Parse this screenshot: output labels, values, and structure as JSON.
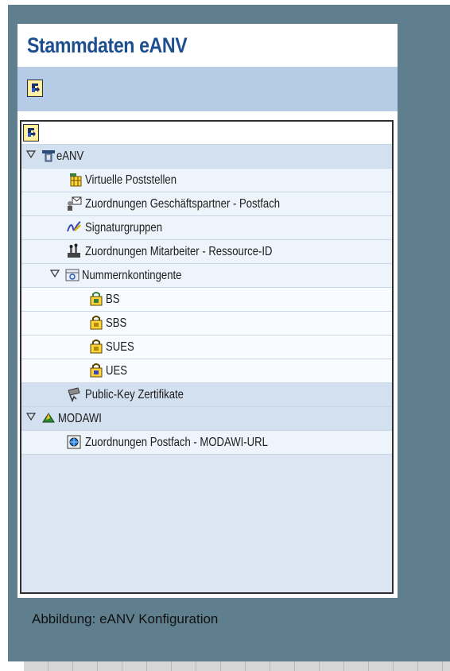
{
  "header": {
    "title": "Stammdaten eANV"
  },
  "toolbar": {
    "refresh_icon": "refresh-icon"
  },
  "tree": {
    "nodes": [
      {
        "label": "eANV",
        "icon": "eanv-node-icon",
        "expanded": true,
        "level": 0
      },
      {
        "label": "Virtuelle Poststellen",
        "icon": "virtual-mailbox-icon",
        "level": 1
      },
      {
        "label": "Zuordnungen Geschäftspartner - Postfach",
        "icon": "partner-mailbox-icon",
        "level": 1
      },
      {
        "label": "Signaturgruppen",
        "icon": "signature-icon",
        "level": 1
      },
      {
        "label": "Zuordnungen Mitarbeiter - Ressource-ID",
        "icon": "employee-resource-icon",
        "level": 1
      },
      {
        "label": "Nummernkontingente",
        "icon": "number-range-icon",
        "expanded": true,
        "level": 1
      },
      {
        "label": "BS",
        "icon": "contingent-icon",
        "level": 2
      },
      {
        "label": "SBS",
        "icon": "contingent-icon",
        "level": 2
      },
      {
        "label": "SUES",
        "icon": "contingent-icon",
        "level": 2
      },
      {
        "label": "UES",
        "icon": "contingent-icon",
        "level": 2
      },
      {
        "label": "Public-Key Zertifikate",
        "icon": "certificate-icon",
        "level": 1
      },
      {
        "label": "MODAWI",
        "icon": "modawi-node-icon",
        "expanded": true,
        "level": 0
      },
      {
        "label": "Zuordnungen Postfach - MODAWI-URL",
        "icon": "url-mapping-icon",
        "level": 1
      }
    ]
  },
  "caption": "Abbildung: eANV Konfiguration"
}
